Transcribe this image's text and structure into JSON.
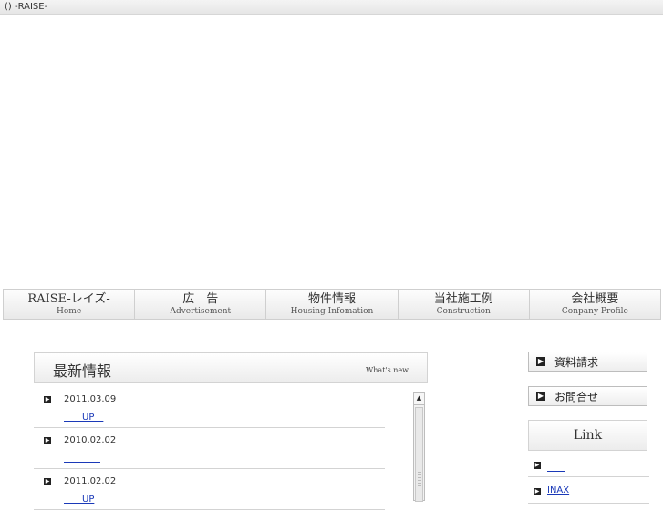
{
  "window": {
    "title": "() -RAISE-"
  },
  "nav": [
    {
      "label": "RAISE-レイズ-",
      "sub": "Home"
    },
    {
      "label": "広　告",
      "sub": "Advertisement"
    },
    {
      "label": "物件情報",
      "sub": "Housing Infomation"
    },
    {
      "label": "当社施工例",
      "sub": "Construction"
    },
    {
      "label": "会社概要",
      "sub": "Conpany Profile"
    }
  ],
  "news": {
    "title": "最新情報",
    "subtitle": "What's new",
    "items": [
      {
        "date": "2011.03.09",
        "link": "　　UP　"
      },
      {
        "date": "2010.02.02",
        "link": "　　　　"
      },
      {
        "date": "2011.02.02",
        "link": "　　UP"
      }
    ]
  },
  "sidebar": {
    "request_button": "資料請求",
    "contact_button": "お問合せ",
    "link_header": "Link",
    "links": [
      {
        "label": "　　"
      },
      {
        "label": "INAX"
      }
    ]
  }
}
